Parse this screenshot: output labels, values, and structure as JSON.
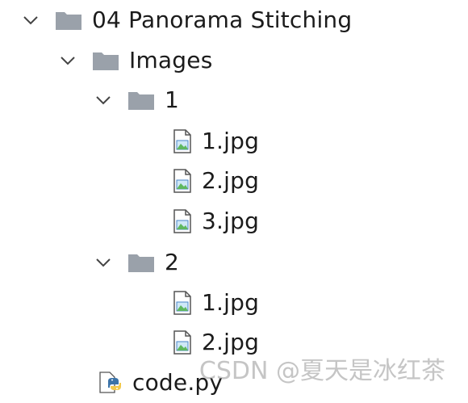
{
  "tree": {
    "root": {
      "label": "04 Panorama Stitching",
      "expanded": true
    },
    "images_folder": {
      "label": "Images",
      "expanded": true
    },
    "folder_1": {
      "label": "1",
      "expanded": true,
      "files": [
        "1.jpg",
        "2.jpg",
        "3.jpg"
      ]
    },
    "folder_2": {
      "label": "2",
      "expanded": true,
      "files": [
        "1.jpg",
        "2.jpg"
      ]
    },
    "code_file": {
      "label": "code.py"
    }
  },
  "watermark": "CSDN @夏天是冰红茶",
  "colors": {
    "folder": "#9aa1aa",
    "chevron": "#444444",
    "image_icon_green": "#5fb85f",
    "image_icon_blue": "#4a86c8",
    "python_blue": "#3b73a8",
    "python_yellow": "#f2c94c"
  }
}
